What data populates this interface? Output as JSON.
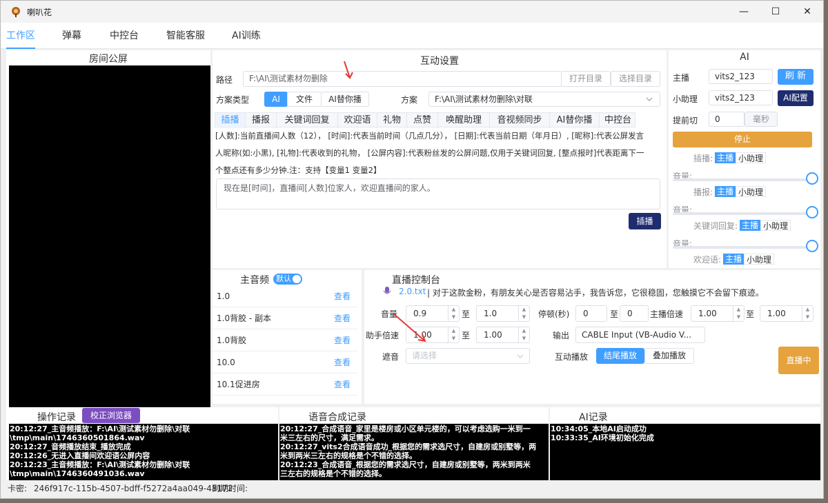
{
  "window": {
    "title": "喇叭花",
    "minimize": "—",
    "maximize": "☐",
    "close": "✕"
  },
  "nav": {
    "tabs": [
      "工作区",
      "弹幕",
      "中控台",
      "智能客服",
      "AI训练"
    ],
    "active": 0
  },
  "room": {
    "title": "房间公屏"
  },
  "interact": {
    "title": "互动设置",
    "path_label": "路径",
    "path_value": "F:\\AI\\测试素材勿删除",
    "open_dir": "打开目录",
    "choose_dir": "选择目录",
    "scheme_type_label": "方案类型",
    "scheme_types": [
      "AI",
      "文件",
      "AI替你播"
    ],
    "scheme_label": "方案",
    "scheme_value": "F:\\AI\\测试素材勿删除\\对联",
    "subtabs": [
      "插播",
      "播报",
      "关键词回复",
      "欢迎语",
      "礼物",
      "点赞",
      "唤醒助理",
      "音视频同步",
      "AI替你播",
      "中控台"
    ],
    "desc_lines": [
      "[人数]:当前直播间人数（12）， [时间]:代表当前时间（几点几分）， [日期]:代表当前日期（年月日）, [昵称]:代表公屏发言",
      "人昵称(如:小黑), [礼物]:代表收到的礼物， [公屏内容]:代表粉丝发的公屏问题,仅用于关键词回复, [整点报时]代表距离下一",
      "个整点还有多少分钟.注：支持【变量1 变量2】"
    ],
    "textarea": "现在是[时间]，直播间[人数]位家人，欢迎直播间的家人。",
    "insert_btn": "插播"
  },
  "ai": {
    "title": "AI",
    "host_label": "主播",
    "host_value": "vits2_123",
    "refresh": "刷 新",
    "assistant_label": "小助理",
    "assistant_value": "vits2_123",
    "config": "AI配置",
    "advance_label": "提前切",
    "advance_value": "0",
    "advance_unit": "毫秒",
    "stop": "停止",
    "rows": [
      {
        "label": "插播:",
        "a": "主播",
        "b": "小助理"
      },
      {
        "label": "播报:",
        "a": "主播",
        "b": "小助理"
      },
      {
        "label": "关键词回复:",
        "a": "主播",
        "b": "小助理"
      },
      {
        "label": "欢迎语:",
        "a": "主播",
        "b": "小助理"
      }
    ],
    "volume_label": "音量:"
  },
  "audio": {
    "title": "主音频",
    "toggle": "默认",
    "view": "查看",
    "items": [
      "1.0",
      "1.0背胶 - 副本",
      "1.0背胶",
      "10.0",
      "10.1促进房"
    ]
  },
  "live": {
    "title": "直播控制台",
    "file": "2.0.txt",
    "line": "对于这款金粉，有朋友关心是否容易沾手，我告诉您，它很稳固，您触摸它不会留下痕迹。",
    "vol_label": "音量",
    "vol_min": "0.9",
    "to": "至",
    "vol_max": "1.0",
    "pause_label": "停顿(秒)",
    "pause_min": "0",
    "pause_max": "0",
    "speed_label": "主播倍速",
    "speed_min": "1.00",
    "speed_max": "1.00",
    "asst_speed_label": "助手倍速",
    "asst_min": "1.00",
    "asst_max": "1.00",
    "output_label": "输出",
    "output_value": "CABLE Input (VB-Audio V...",
    "mask_label": "遮音",
    "mask_placeholder": "请选择",
    "interact_label": "互动播放",
    "mode_a": "结尾播放",
    "mode_b": "叠加播放",
    "live_btn": "直播中"
  },
  "logs": {
    "ops_title": "操作记录",
    "calibrate": "校正浏览器",
    "ops": [
      "20:12:27_主音频播放：F:\\AI\\测试素材勿删除\\对联",
      "\\tmp\\main\\1746360501864.wav",
      "20:12:27_音频播放结束_播放完成",
      "20:12:26_无进入直播间欢迎语公屏内容",
      "20:12:23_主音频播放：F:\\AI\\测试素材勿删除\\对联",
      "\\tmp\\main\\1746360491036.wav"
    ],
    "tts_title": "语音合成记录",
    "tts": [
      "20:12:27_合成语音_家里是楼房或小区单元楼的，可以考虑选购一米到一",
      "米三左右的尺寸，满足需求。",
      "20:12:27_vits2合成语音成功_根据您的需求选尺寸，自建房或别墅等，两",
      "米到两米三左右的规格是个不错的选择。",
      "20:12:23_合成语音_根据您的需求选尺寸，自建房或别墅等，两米到两米",
      "三左右的规格是个不错的选择。"
    ],
    "ai_title": "AI记录",
    "ai": [
      "10:34:05_本地AI启动成功",
      "10:33:35_AI环境初始化完成"
    ]
  },
  "status": {
    "key_label": "卡密:",
    "key_value": "246f917c-115b-4507-bdff-f5272a4aa049-48172",
    "expire_label": "到期时间:"
  }
}
